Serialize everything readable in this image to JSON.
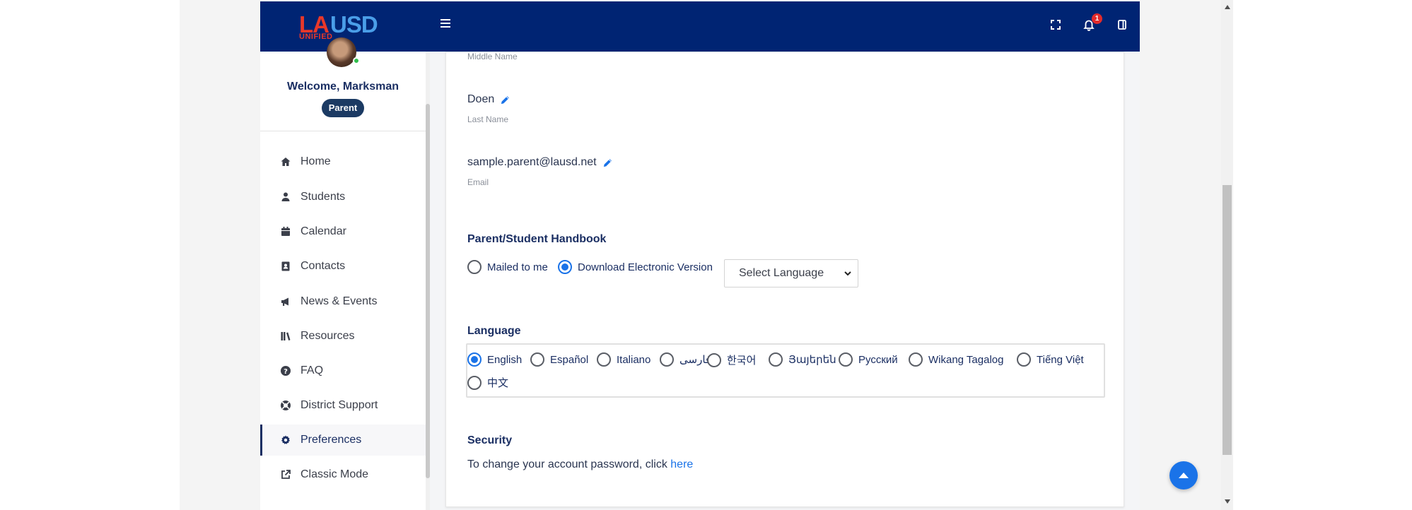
{
  "header": {
    "logo": {
      "la": "LA",
      "usd": "USD",
      "unified": "UNIFIED"
    },
    "notifications_count": "1",
    "icons": [
      "hamburger-menu-icon",
      "fullscreen-icon",
      "bell-icon",
      "panel-icon"
    ]
  },
  "sidebar": {
    "welcome": "Welcome, Marksman",
    "role": "Parent",
    "items": [
      {
        "label": "Home",
        "icon": "home-icon"
      },
      {
        "label": "Students",
        "icon": "user-icon"
      },
      {
        "label": "Calendar",
        "icon": "calendar-icon"
      },
      {
        "label": "Contacts",
        "icon": "contact-card-icon"
      },
      {
        "label": "News & Events",
        "icon": "megaphone-icon"
      },
      {
        "label": "Resources",
        "icon": "books-icon"
      },
      {
        "label": "FAQ",
        "icon": "question-circle-icon"
      },
      {
        "label": "District Support",
        "icon": "life-ring-icon"
      },
      {
        "label": "Preferences",
        "icon": "gear-icon",
        "active": true
      },
      {
        "label": "Classic Mode",
        "icon": "external-link-icon"
      }
    ]
  },
  "profile": {
    "middle_name_label": "Middle Name",
    "last_name": "Doen",
    "last_name_label": "Last Name",
    "email": "sample.parent@lausd.net",
    "email_label": "Email"
  },
  "handbook": {
    "title": "Parent/Student Handbook",
    "options": [
      {
        "label": "Mailed to me",
        "checked": false
      },
      {
        "label": "Download Electronic Version",
        "checked": true
      }
    ],
    "select_placeholder": "Select Language"
  },
  "language": {
    "title": "Language",
    "options": [
      {
        "label": "English",
        "checked": true
      },
      {
        "label": "Español",
        "checked": false
      },
      {
        "label": "Italiano",
        "checked": false
      },
      {
        "label": "فارسی",
        "checked": false
      },
      {
        "label": "한국어",
        "checked": false
      },
      {
        "label": "Յայերեն",
        "checked": false
      },
      {
        "label": "Русский",
        "checked": false
      },
      {
        "label": "Wikang Tagalog",
        "checked": false
      },
      {
        "label": "Tiếng Việt",
        "checked": false
      },
      {
        "label": "中文",
        "checked": false
      }
    ]
  },
  "security": {
    "title": "Security",
    "text": "To change your account password, click",
    "link": "here"
  },
  "colors": {
    "header_bg": "#002473",
    "accent": "#1a73e8",
    "title_text": "#1b2f63",
    "badge_red": "#e32b2b"
  }
}
